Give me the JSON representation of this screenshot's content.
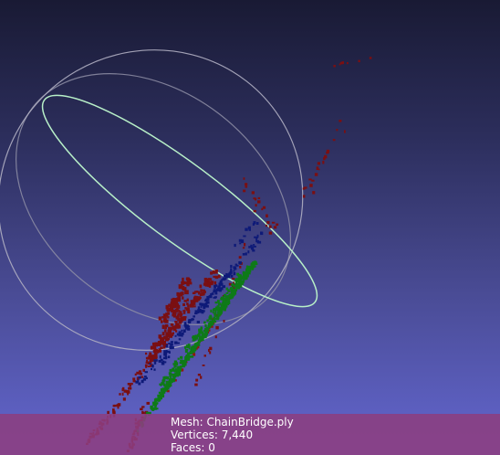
{
  "mesh_info": {
    "mesh_label": "Mesh: ChainBridge.ply",
    "vertices_label": "Vertices: 7,440",
    "faces_label": "Faces: 0"
  },
  "colors": {
    "background_top": "#191a34",
    "background_bottom": "#6366cf",
    "info_bar": "#8c3e80",
    "trackball_ring": "#a8a8b8",
    "trackball_highlight": "#b8f0c8",
    "points_red": "#7a0f12",
    "points_blue": "#0e1a78",
    "points_green": "#0e7a18"
  }
}
